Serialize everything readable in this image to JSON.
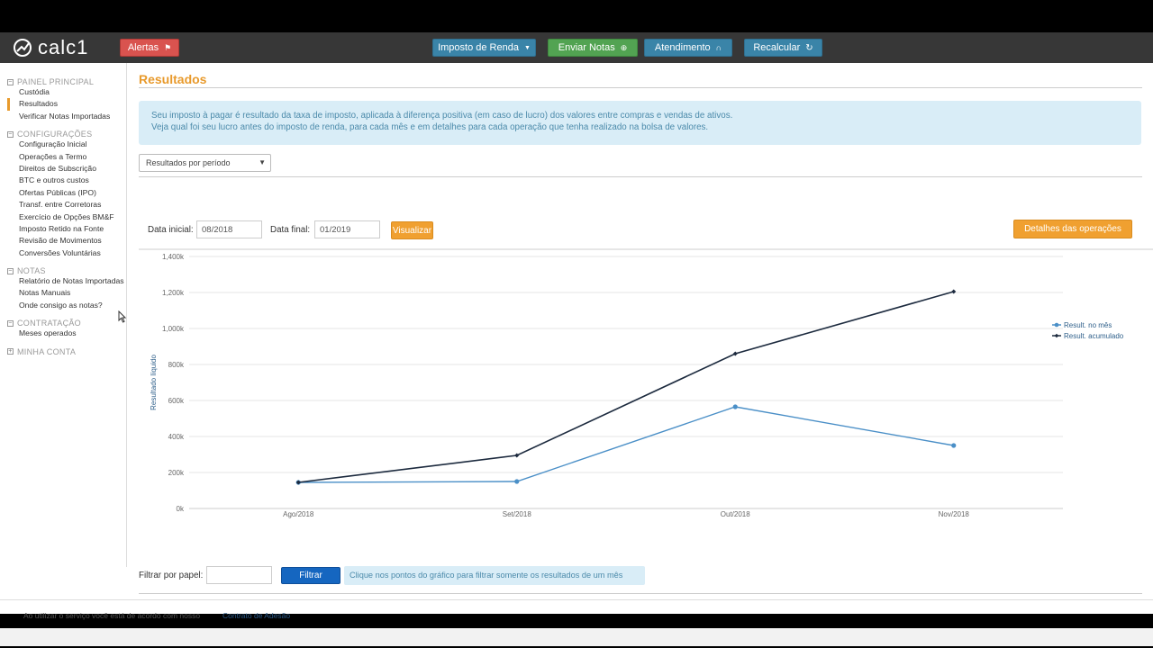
{
  "app": {
    "logo_text": "calc1"
  },
  "topbar": {
    "alerts_label": "Alertas",
    "menu": [
      {
        "label": "Imposto de Renda",
        "icon": "caret-down-icon"
      },
      {
        "label": "Enviar Notas",
        "icon": "upload-icon"
      },
      {
        "label": "Atendimento",
        "icon": "headphones-icon"
      },
      {
        "label": "Recalcular",
        "icon": "refresh-icon"
      }
    ]
  },
  "sidebar": {
    "sections": [
      {
        "title": "PAINEL PRINCIPAL",
        "toggle": "−",
        "items": [
          "Custódia",
          "Resultados",
          "Verificar Notas Importadas"
        ]
      },
      {
        "title": "CONFIGURAÇÕES",
        "toggle": "−",
        "items": [
          "Configuração Inicial",
          "Operações a Termo",
          "Direitos de Subscrição",
          "BTC e outros custos",
          "Ofertas Públicas (IPO)",
          "Transf. entre Corretoras",
          "Exercício de Opções BM&F",
          "Imposto Retido na Fonte",
          "Revisão de Movimentos",
          "Conversões Voluntárias"
        ]
      },
      {
        "title": "NOTAS",
        "toggle": "−",
        "items": [
          "Relatório de Notas Importadas",
          "Notas Manuais",
          "Onde consigo as notas?"
        ]
      },
      {
        "title": "CONTRATAÇÃO",
        "toggle": "−",
        "items": [
          "Meses operados"
        ]
      },
      {
        "title": "MINHA CONTA",
        "toggle": "+",
        "items": []
      }
    ],
    "active_item": "Resultados"
  },
  "main": {
    "title": "Resultados",
    "info_line1": "Seu imposto à pagar é resultado da taxa de imposto, aplicada à diferença positiva (em caso de lucro) dos valores entre compras e vendas de ativos.",
    "info_line2": "Veja qual foi seu lucro antes do imposto de renda, para cada mês e em detalhes para cada operação que tenha realizado na bolsa de valores.",
    "period_select": "Resultados por período",
    "data_inicial_label": "Data inicial:",
    "data_inicial_value": "08/2018",
    "data_final_label": "Data final:",
    "data_final_value": "01/2019",
    "visualizar_label": "Visualizar",
    "detalhes_label": "Detalhes das operações",
    "filtrar_label": "Filtrar por papel:",
    "filtrar_value": "",
    "filtrar_button": "Filtrar",
    "filtrar_hint": "Clique nos pontos do gráfico para filtrar somente os resultados de um mês"
  },
  "chart_data": {
    "type": "line",
    "categories": [
      "Ago/2018",
      "Set/2018",
      "Out/2018",
      "Nov/2018"
    ],
    "series": [
      {
        "name": "Result. no mês",
        "values": [
          145000,
          150000,
          565000,
          350000
        ],
        "color": "#4a8fc7"
      },
      {
        "name": "Result. acumulado",
        "values": [
          145000,
          295000,
          860000,
          1205000
        ],
        "color": "#1c2a3e"
      }
    ],
    "ylabel": "Resultado líquido",
    "ylim": [
      0,
      1400000
    ],
    "yticks": [
      "0k",
      "200k",
      "400k",
      "600k",
      "800k",
      "1,000k",
      "1,200k",
      "1,400k"
    ],
    "grid": true,
    "legend": "right"
  },
  "footer": {
    "text": "Ao utilizar o serviço você está de acordo com nosso",
    "link": "Contrato de Adesão"
  },
  "colors": {
    "accent": "#e89a2c",
    "topbar": "#373737",
    "info_bg": "#d9edf7"
  }
}
